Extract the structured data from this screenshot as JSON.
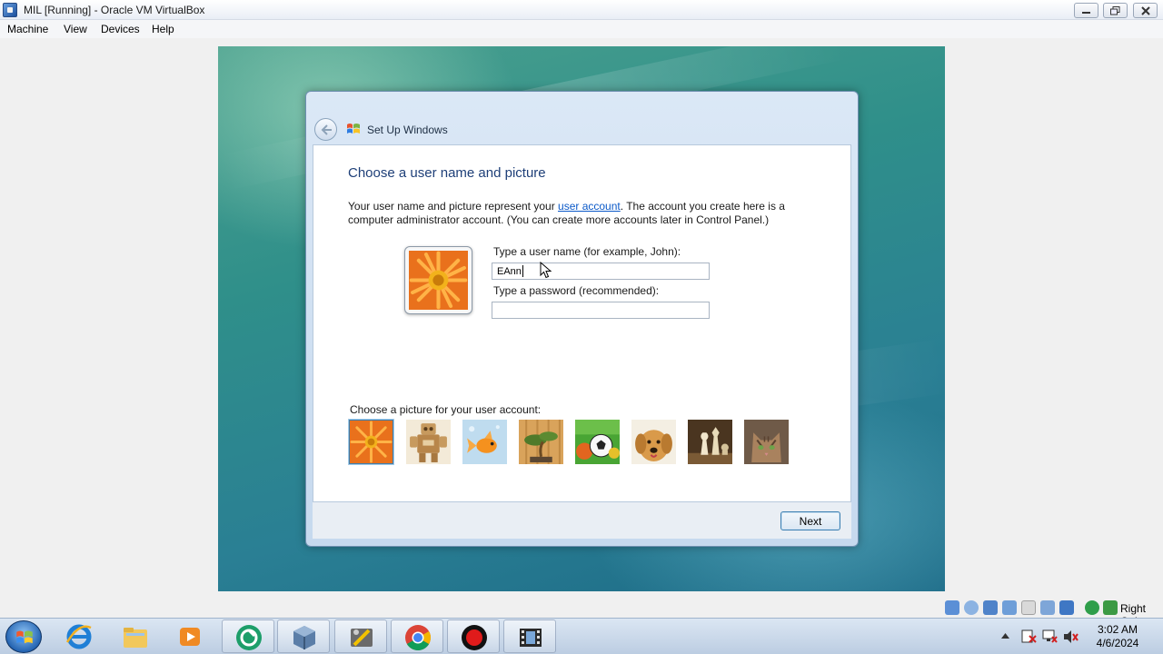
{
  "host_window": {
    "title": "MIL [Running] - Oracle VM VirtualBox",
    "menu": [
      "Machine",
      "View",
      "Devices",
      "Help"
    ]
  },
  "setup": {
    "window_title": "Set Up Windows",
    "heading": "Choose a user name and picture",
    "description_prefix": "Your user name and picture represent your ",
    "description_link": "user account",
    "description_suffix": ". The account you create here is a computer administrator account. (You can create more accounts later in Control Panel.)",
    "username_label": "Type a user name (for example, John):",
    "username_value": "EAnn",
    "password_label": "Type a password (recommended):",
    "password_value": "",
    "picture_label": "Choose a picture for your user account:",
    "pictures": [
      "flower",
      "robot",
      "goldfish",
      "bonsai",
      "soccer-ball",
      "dog",
      "chess",
      "kitten"
    ],
    "selected_picture": "flower",
    "next_label": "Next"
  },
  "vbox_status": {
    "host_key": "Right Ctrl"
  },
  "taskbar": {
    "apps": [
      "internet-explorer",
      "file-explorer",
      "media-player",
      "app-green-circle",
      "virtualbox",
      "tools",
      "chrome",
      "record",
      "video-editor"
    ],
    "time": "3:02 AM",
    "date": "4/6/2024"
  },
  "colors": {
    "heading": "#1e3f78",
    "link": "#0b59c8",
    "desktop": "#2f8f8a"
  }
}
